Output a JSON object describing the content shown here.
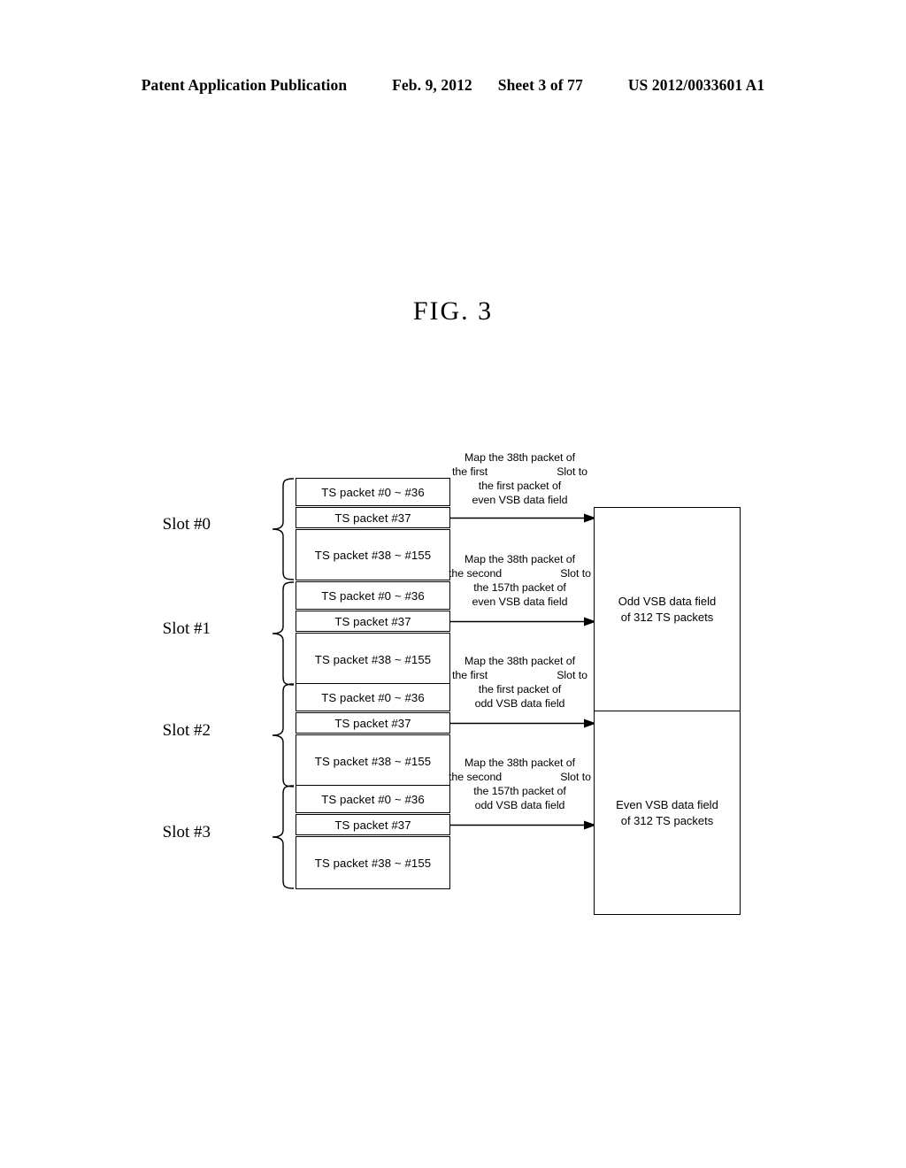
{
  "header": {
    "publication": "Patent Application Publication",
    "date": "Feb. 9, 2012",
    "sheet": "Sheet 3 of 77",
    "patent_number": "US 2012/0033601 A1"
  },
  "figure": {
    "title": "FIG. 3"
  },
  "slots": [
    {
      "label": "Slot #0",
      "rows": [
        {
          "text": "TS packet #0 ~ #36"
        },
        {
          "text": "TS packet #37"
        },
        {
          "text": "TS packet #38 ~ #155"
        }
      ]
    },
    {
      "label": "Slot #1",
      "rows": [
        {
          "text": "TS packet #0 ~ #36"
        },
        {
          "text": "TS packet #37"
        },
        {
          "text": "TS packet #38 ~ #155"
        }
      ]
    },
    {
      "label": "Slot #2",
      "rows": [
        {
          "text": "TS packet #0 ~ #36"
        },
        {
          "text": "TS packet #37"
        },
        {
          "text": "TS packet #38 ~ #155"
        }
      ]
    },
    {
      "label": "Slot #3",
      "rows": [
        {
          "text": "TS packet #0 ~ #36"
        },
        {
          "text": "TS packet #37"
        },
        {
          "text": "TS packet #38 ~ #155"
        }
      ]
    }
  ],
  "annotations": [
    {
      "line1": "Map the 38th packet of",
      "line2_left": "the first",
      "line2_right": "Slot to",
      "line3": "the first packet of",
      "line4": "even VSB  data field"
    },
    {
      "line1": "Map the 38th packet of",
      "line2_left": "the second",
      "line2_right": "Slot to",
      "line3": "the 157th packet of",
      "line4": "even VSB data field"
    },
    {
      "line1": "Map the 38th packet of",
      "line2_left": "the first",
      "line2_right": "Slot to",
      "line3": "the first packet of",
      "line4": "odd VSB  data field"
    },
    {
      "line1": "Map the 38th packet of",
      "line2_left": "the second",
      "line2_right": "Slot to",
      "line3": "the 157th packet of",
      "line4": "odd VSB data field"
    }
  ],
  "vsb_fields": [
    {
      "line1": "Odd VSB data field",
      "line2": "of 312 TS packets"
    },
    {
      "line1": "Even VSB data field",
      "line2": "of 312 TS packets"
    }
  ],
  "colors": {
    "ink": "#000000",
    "paper": "#ffffff"
  }
}
